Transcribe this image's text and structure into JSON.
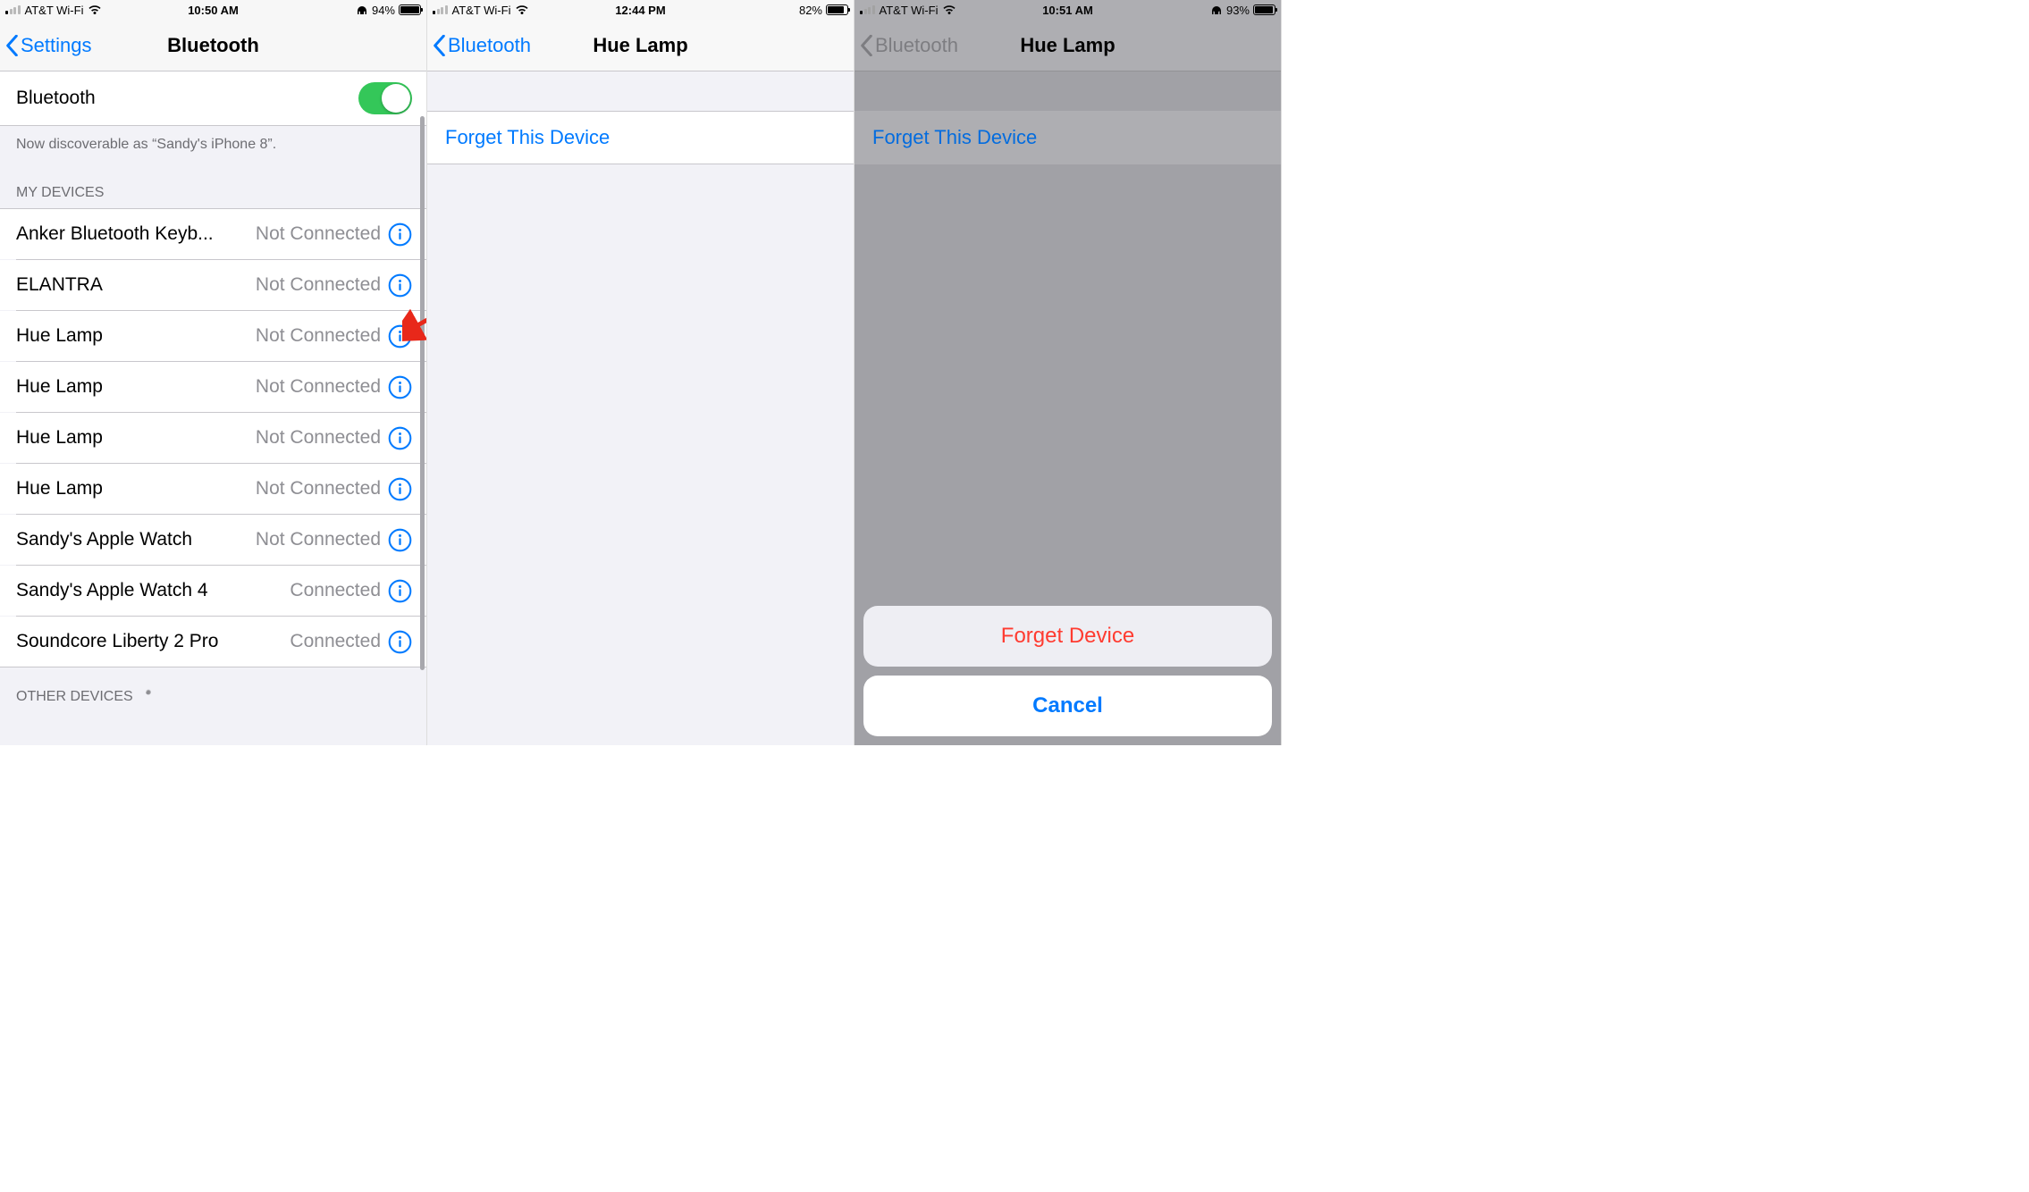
{
  "phone1": {
    "status": {
      "carrier": "AT&T Wi-Fi",
      "time": "10:50 AM",
      "battery_pct": "94%",
      "battery_fill": 90,
      "headphones": true
    },
    "nav": {
      "back": "Settings",
      "title": "Bluetooth"
    },
    "bt_toggle_label": "Bluetooth",
    "discoverable": "Now discoverable as “Sandy's iPhone 8”.",
    "section_my": "MY DEVICES",
    "devices": [
      {
        "name": "Anker Bluetooth Keyb...",
        "status": "Not Connected"
      },
      {
        "name": "ELANTRA",
        "status": "Not Connected"
      },
      {
        "name": "Hue Lamp",
        "status": "Not Connected"
      },
      {
        "name": "Hue Lamp",
        "status": "Not Connected"
      },
      {
        "name": "Hue Lamp",
        "status": "Not Connected"
      },
      {
        "name": "Hue Lamp",
        "status": "Not Connected"
      },
      {
        "name": "Sandy's Apple Watch",
        "status": "Not Connected"
      },
      {
        "name": "Sandy's Apple Watch 4",
        "status": "Connected"
      },
      {
        "name": "Soundcore Liberty 2 Pro",
        "status": "Connected"
      }
    ],
    "section_other": "OTHER DEVICES"
  },
  "phone2": {
    "status": {
      "carrier": "AT&T Wi-Fi",
      "time": "12:44 PM",
      "battery_pct": "82%",
      "battery_fill": 78,
      "headphones": false
    },
    "nav": {
      "back": "Bluetooth",
      "title": "Hue Lamp"
    },
    "forget": "Forget This Device"
  },
  "phone3": {
    "status": {
      "carrier": "AT&T Wi-Fi",
      "time": "10:51 AM",
      "battery_pct": "93%",
      "battery_fill": 89,
      "headphones": true
    },
    "nav": {
      "back": "Bluetooth",
      "title": "Hue Lamp"
    },
    "forget": "Forget This Device",
    "sheet": {
      "forget": "Forget Device",
      "cancel": "Cancel"
    }
  }
}
